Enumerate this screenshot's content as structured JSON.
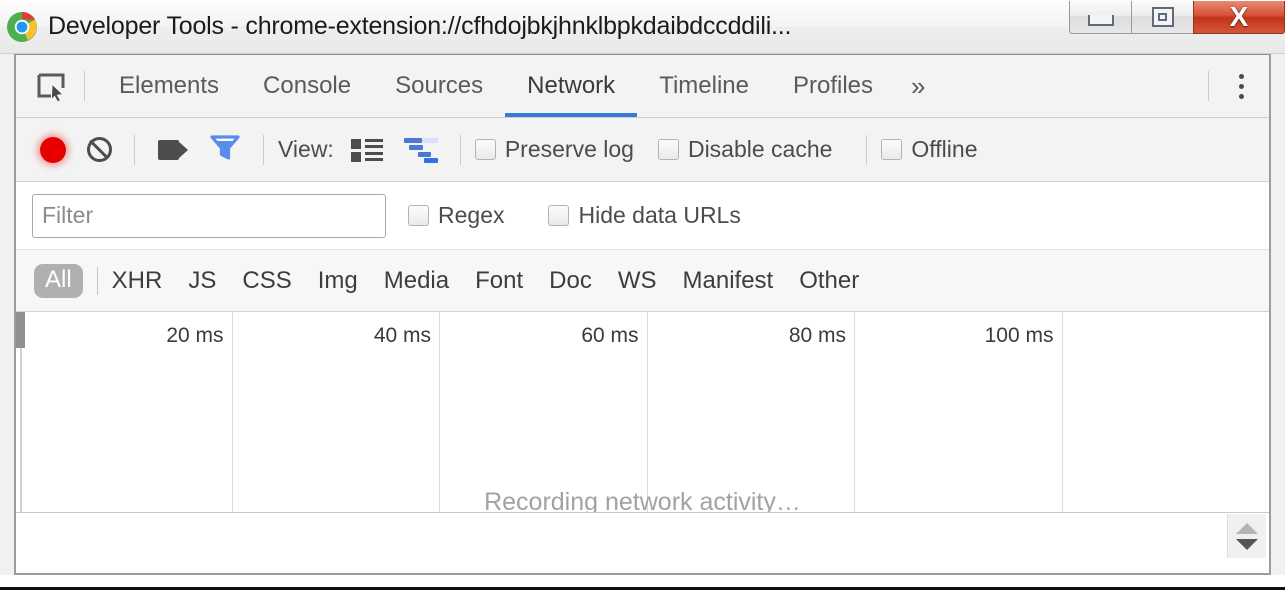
{
  "window": {
    "title": "Developer Tools - chrome-extension://cfhdojbkjhnklbpkdaibdccddili...",
    "logo_icon": "chrome-logo-icon",
    "controls": {
      "minimize": "minimize-icon",
      "maximize": "restore-icon",
      "close": "X"
    }
  },
  "tabstrip": {
    "inspect_icon": "inspect-element-icon",
    "tabs": [
      {
        "label": "Elements",
        "active": false
      },
      {
        "label": "Console",
        "active": false
      },
      {
        "label": "Sources",
        "active": false
      },
      {
        "label": "Network",
        "active": true
      },
      {
        "label": "Timeline",
        "active": false
      },
      {
        "label": "Profiles",
        "active": false
      }
    ],
    "more_label": "»",
    "menu_icon": "kebab-menu-icon"
  },
  "toolbar": {
    "record_icon": "record-icon",
    "clear_icon": "clear-icon",
    "camera_icon": "camera-icon",
    "filter_icon": "funnel-filter-icon",
    "view_label": "View:",
    "view_list_icon": "list-view-icon",
    "view_waterfall_icon": "waterfall-view-icon",
    "checkboxes": [
      {
        "label": "Preserve log",
        "checked": false
      },
      {
        "label": "Disable cache",
        "checked": false
      },
      {
        "label": "Offline",
        "checked": false
      }
    ]
  },
  "filter_row": {
    "input_value": "",
    "input_placeholder": "Filter",
    "checkboxes": [
      {
        "label": "Regex",
        "checked": false
      },
      {
        "label": "Hide data URLs",
        "checked": false
      }
    ]
  },
  "type_filters": {
    "selected": "All",
    "items": [
      "XHR",
      "JS",
      "CSS",
      "Img",
      "Media",
      "Font",
      "Doc",
      "WS",
      "Manifest",
      "Other"
    ]
  },
  "timeline": {
    "ticks": [
      "20 ms",
      "40 ms",
      "60 ms",
      "80 ms",
      "100 ms"
    ],
    "overlay_message": "Recording network activity…"
  },
  "bottom": {
    "scroll_up_icon": "scroll-up-arrow-icon",
    "scroll_down_icon": "scroll-down-arrow-icon"
  },
  "colors": {
    "accent": "#3879d9",
    "record": "#e70000",
    "filter_active": "#5a8cec",
    "close_button": "#c0341a"
  }
}
